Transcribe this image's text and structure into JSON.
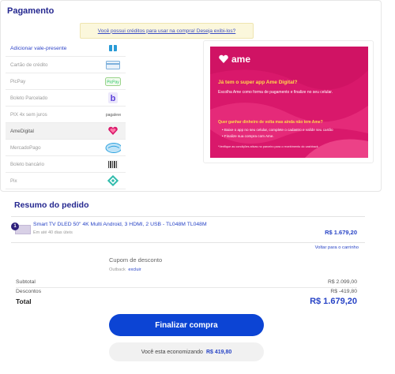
{
  "payment": {
    "title": "Pagamento",
    "credit_banner": "Você possui créditos para usar na compra! Deseja exibi-los?",
    "methods": [
      {
        "label": "Adicionar vale-presente",
        "icon": "gift-card-icon"
      },
      {
        "label": "Cartão de crédito",
        "icon": "credit-card-icon"
      },
      {
        "label": "PicPay",
        "icon": "picpay-icon"
      },
      {
        "label": "Boleto Parcelado",
        "icon": "boleto-parcelado-icon"
      },
      {
        "label": "PIX 4x sem juros",
        "icon": "pix-parcelado-icon",
        "icon_text": "pagaleve"
      },
      {
        "label": "AmeDigital",
        "icon": "ame-heart-icon"
      },
      {
        "label": "MercadoPago",
        "icon": "mercadopago-icon"
      },
      {
        "label": "Boleto bancário",
        "icon": "barcode-icon"
      },
      {
        "label": "Pix",
        "icon": "pix-icon"
      }
    ],
    "ame": {
      "logo": "ame",
      "question": "Já tem o super app Ame Digital?",
      "subtitle": "Escolha Ame como forma de pagamento e finalize no seu celular.",
      "question2": "Quer ganhar dinheiro de volta mas ainda não tem Ame?",
      "steps": [
        "Baixe o app no seu celular, complete o cadastro e valide seu cartão",
        "Finalize sua compra com Ame."
      ],
      "note": "*Verifique as condições ativas no parceiro para o recebimento do cashback",
      "accent": "#d9186b"
    }
  },
  "summary": {
    "title": "Resumo do pedido",
    "product": {
      "qty": "1",
      "name": "Smart TV DLED 50\" 4K Multi Android, 3 HDMI, 2 USB - TL048M TL048M",
      "delivery": "Em até 40 dias úteis",
      "price": "R$ 1.679,20"
    },
    "back_link": "Voltar para o carrinho",
    "coupon": {
      "title": "Cupom de desconto",
      "code": "Outback",
      "remove": "excluir"
    },
    "subtotal_label": "Subtotal",
    "subtotal_value": "R$ 2.099,00",
    "discount_label": "Descontos",
    "discount_value": "R$ -419,80",
    "total_label": "Total",
    "total_value": "R$ 1.679,20",
    "finish_button": "Finalizar compra",
    "saving_label": "Você esta economizando",
    "saving_value": "R$ 419,80"
  },
  "colors": {
    "brand_blue": "#0c44d4",
    "title_navy": "#24278f"
  }
}
